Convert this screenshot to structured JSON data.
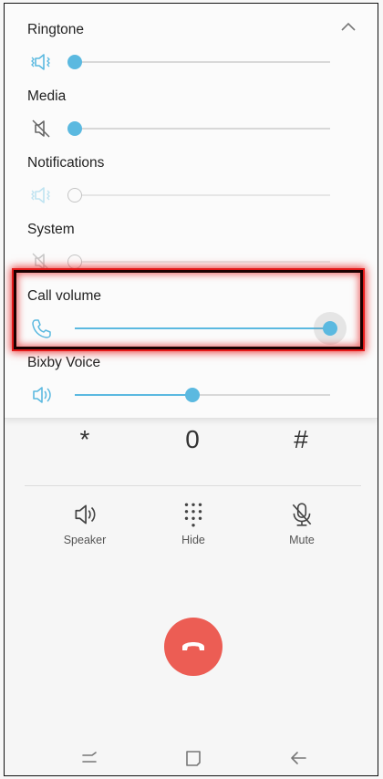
{
  "volume_panel": {
    "collapse_icon": "chevron-up-icon",
    "rows": [
      {
        "label": "Ringtone",
        "icon": "vibrate-icon",
        "level": 0,
        "active": true
      },
      {
        "label": "Media",
        "icon": "mute-icon",
        "level": 0,
        "active": true
      },
      {
        "label": "Notifications",
        "icon": "vibrate-icon",
        "level": 0,
        "active": false
      },
      {
        "label": "System",
        "icon": "mute-icon",
        "level": 0,
        "active": false
      },
      {
        "label": "Call volume",
        "icon": "phone-icon",
        "level": 1.0,
        "active": true,
        "highlighted": true
      },
      {
        "label": "Bixby Voice",
        "icon": "speaker-icon",
        "level": 0.5,
        "active": true
      }
    ]
  },
  "dialpad": {
    "keys": [
      "*",
      "0",
      "#"
    ]
  },
  "call_actions": [
    {
      "label": "Speaker",
      "icon": "speaker-icon"
    },
    {
      "label": "Hide",
      "icon": "keypad-icon"
    },
    {
      "label": "Mute",
      "icon": "microphone-off-icon"
    }
  ],
  "end_call": {
    "icon": "end-call-icon"
  },
  "nav": {
    "icons": [
      "recents-icon",
      "home-icon",
      "back-icon"
    ]
  },
  "colors": {
    "accent": "#5bb9e0",
    "end_call": "#ec5d54",
    "highlight": "#e41a1a"
  }
}
